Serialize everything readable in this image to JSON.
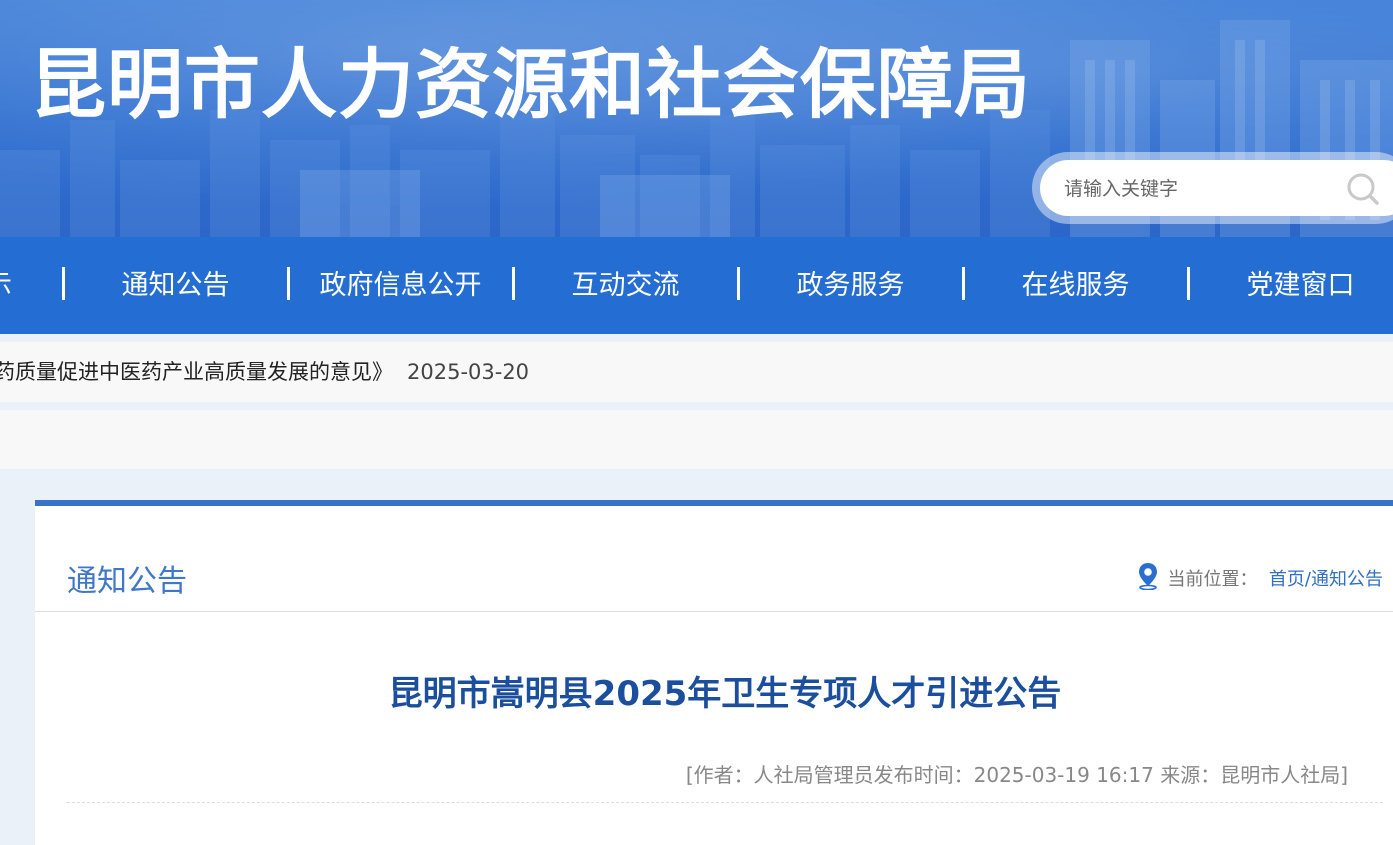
{
  "header": {
    "site_title": "昆明市人力资源和社会保障局",
    "search_placeholder": "请输入关键字"
  },
  "nav": {
    "items": [
      {
        "label": "示"
      },
      {
        "label": "通知公告"
      },
      {
        "label": "政府信息公开"
      },
      {
        "label": "互动交流"
      },
      {
        "label": "政务服务"
      },
      {
        "label": "在线服务"
      },
      {
        "label": "党建窗口"
      }
    ]
  },
  "ticker": {
    "text": "药质量促进中医药产业高质量发展的意见》",
    "date": "2025-03-20"
  },
  "section": {
    "title": "通知公告",
    "location_label": "当前位置：",
    "home_link": "首页",
    "separator": "/",
    "current_link": "通知公告"
  },
  "article": {
    "title": "昆明市嵩明县2025年卫生专项人才引进公告",
    "meta": "[作者：人社局管理员发布时间：2025-03-19 16:17 来源：昆明市人社局]"
  },
  "colors": {
    "nav_bg": "#246dd2",
    "accent": "#3773c8",
    "article_title": "#1b4f9e"
  },
  "icons": [
    "search-icon",
    "location-pin-icon"
  ]
}
